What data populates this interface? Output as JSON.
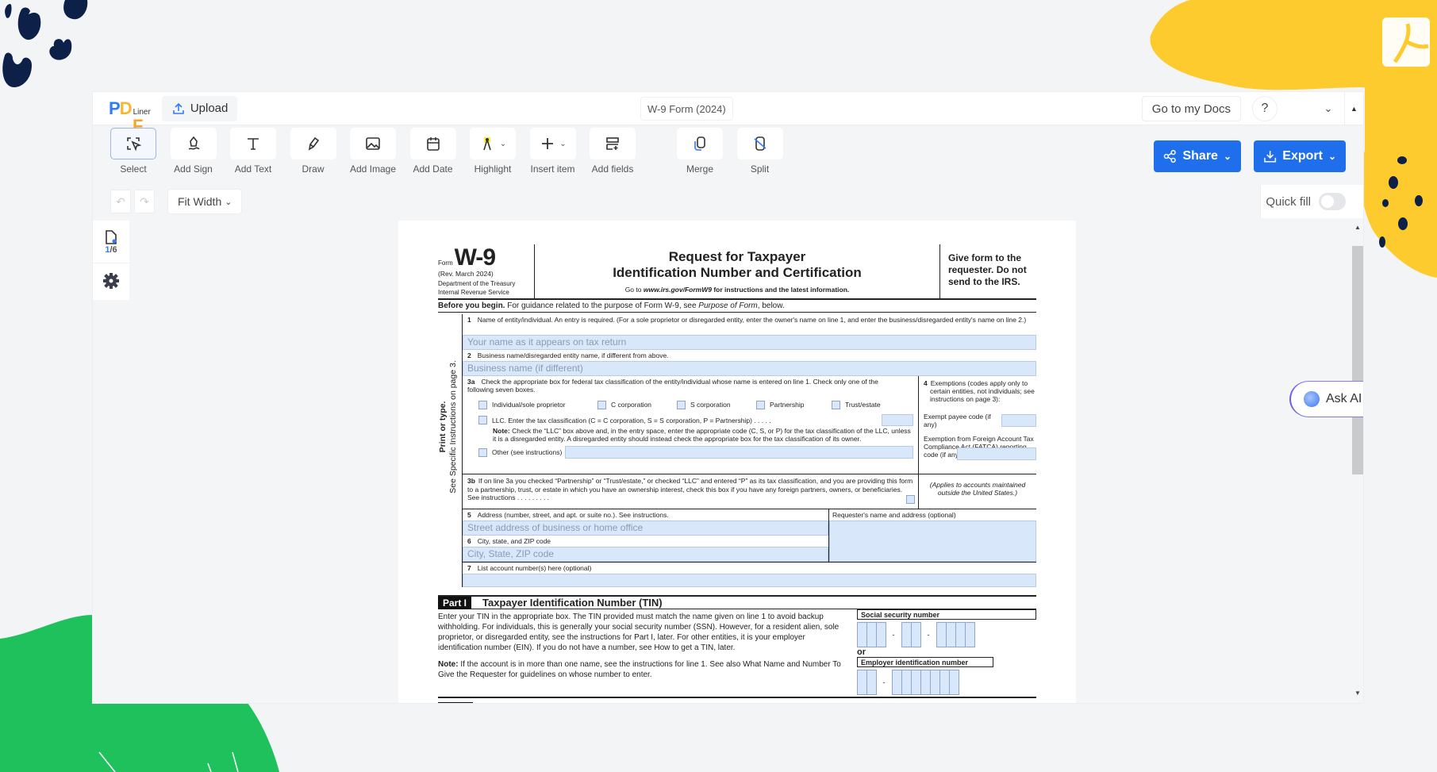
{
  "app": {
    "logo": {
      "p": "P",
      "d": "D",
      "f": "F",
      "liner": "Liner"
    },
    "upload_label": "Upload",
    "document_title": "W-9 Form (2024)",
    "go_to_docs_label": "Go to my Docs",
    "help_label": "?",
    "chevron_down": "⌄",
    "collapse_arrow": "▲"
  },
  "toolbar": {
    "tools": [
      {
        "label": "Select",
        "icon": "select-icon",
        "active": true
      },
      {
        "label": "Add Sign",
        "icon": "sign-icon"
      },
      {
        "label": "Add Text",
        "icon": "text-icon"
      },
      {
        "label": "Draw",
        "icon": "draw-icon"
      },
      {
        "label": "Add Image",
        "icon": "image-icon"
      },
      {
        "label": "Add Date",
        "icon": "calendar-icon"
      },
      {
        "label": "Highlight",
        "icon": "highlight-icon",
        "dropdown": true
      },
      {
        "label": "Insert item",
        "icon": "plus-icon",
        "dropdown": true
      },
      {
        "label": "Add fields",
        "icon": "fields-icon"
      },
      {
        "label": "Merge",
        "icon": "merge-icon"
      },
      {
        "label": "Split",
        "icon": "split-icon"
      }
    ],
    "share_label": "Share",
    "export_label": "Export",
    "dropdown_glyph": "⌄"
  },
  "subbar": {
    "undo": "↶",
    "redo": "↷",
    "zoom_value": "Fit Width",
    "quick_fill_label": "Quick fill",
    "quick_fill_on": false
  },
  "sidebar": {
    "page_current": "1",
    "page_total": "/6"
  },
  "ask_ai_label": "Ask AI",
  "accent_color": "#1f6fec",
  "form": {
    "form_word": "Form",
    "form_name": "W-9",
    "revision": "(Rev. March 2024)",
    "dept1": "Department of the Treasury",
    "dept2": "Internal Revenue Service",
    "title1": "Request for Taxpayer",
    "title2": "Identification Number and Certification",
    "goto_prefix": "Go to ",
    "goto_url": "www.irs.gov/FormW9",
    "goto_suffix": " for instructions and the latest information.",
    "give_form": "Give form to the requester. Do not send to the IRS.",
    "before_begin_bold": "Before you begin.",
    "before_begin_text": " For guidance related to the purpose of Form W-9, see ",
    "before_begin_italic": "Purpose of Form",
    "before_begin_end": ", below.",
    "side_label_1": "Print or type.",
    "side_label_2": "See Specific Instructions on page 3.",
    "line1_num": "1",
    "line1_label": "Name of entity/individual. An entry is required. (For a sole proprietor or disregarded entity, enter the owner's name on line 1, and enter the business/disregarded entity's name on line 2.)",
    "line1_placeholder": "Your name as it appears on tax return",
    "line2_num": "2",
    "line2_label": "Business name/disregarded entity name, if different from above.",
    "line2_placeholder": "Business name (if different)",
    "line3a_num": "3a",
    "line3a_label": "Check the appropriate box for federal tax classification of the entity/individual whose name is entered on line 1. Check only one of the following seven boxes.",
    "classifications": [
      "Individual/sole proprietor",
      "C corporation",
      "S corporation",
      "Partnership",
      "Trust/estate"
    ],
    "llc_label": "LLC. Enter the tax classification (C = C corporation, S = S corporation, P = Partnership)  .  .  .  .  .",
    "note_bold": "Note:",
    "note_text": " Check the “LLC” box above and, in the entry space, enter the appropriate code (C, S, or P) for the tax classification of the LLC, unless it is a disregarded entity. A disregarded entity should instead check the appropriate box for the tax classification of its owner.",
    "other_label": "Other (see instructions)",
    "line3b_num": "3b",
    "line3b_label": "If on line 3a you checked “Partnership” or “Trust/estate,” or checked “LLC” and entered “P” as its tax classification, and you are providing this form to a partnership, trust, or estate in which you have an ownership interest, check this box if you have any foreign partners, owners, or beneficiaries. See instructions  .  .  .  .  .  .  .  .  .",
    "line4_num": "4",
    "line4_label": "Exemptions (codes apply only to certain entities, not individuals; see instructions on page 3):",
    "exempt_payee": "Exempt payee code (if any)",
    "fatca": "Exemption from Foreign Account Tax Compliance Act (FATCA) reporting code (if any)",
    "fatca_note": "(Applies to accounts maintained outside the United States.)",
    "line5_num": "5",
    "line5_label": "Address (number, street, and apt. or suite no.). See instructions.",
    "line5_placeholder": "Street address of business or home office",
    "requester_label": "Requester's name and address (optional)",
    "line6_num": "6",
    "line6_label": "City, state, and ZIP code",
    "line6_placeholder": "City, State, ZIP code",
    "line7_num": "7",
    "line7_label": "List account number(s) here (optional)",
    "part1_tag": "Part I",
    "part1_title": "Taxpayer Identification Number (TIN)",
    "tin_text": "Enter your TIN in the appropriate box. The TIN provided must match the name given on line 1 to avoid backup withholding. For individuals, this is generally your social security number (SSN). However, for a resident alien, sole proprietor, or disregarded entity, see the instructions for Part I, later. For other entities, it is your employer identification number (EIN). If you do not have a number, see How to get a TIN, later.",
    "tin_note_bold": "Note:",
    "tin_note": " If the account is in more than one name, see the instructions for line 1. See also What Name and Number To Give the Requester for guidelines on whose number to enter.",
    "ssn_label": "Social security number",
    "or_label": "or",
    "ein_label": "Employer identification number",
    "dash": "-"
  }
}
